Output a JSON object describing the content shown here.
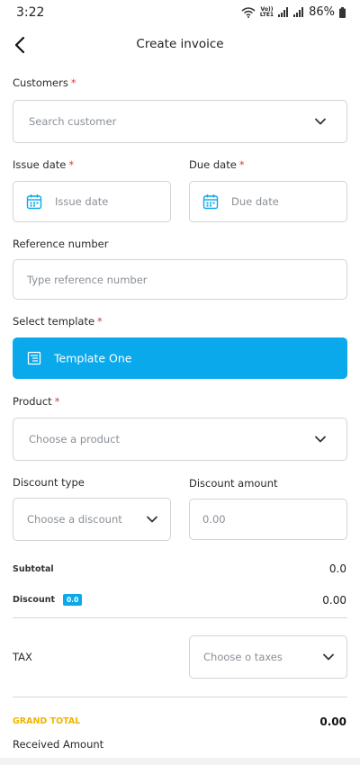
{
  "status": {
    "time": "3:22",
    "lte_top": "Vo))",
    "lte_bottom": "LTE1",
    "battery": "86%"
  },
  "header": {
    "title": "Create invoice"
  },
  "customers": {
    "label": "Customers",
    "required": "*",
    "placeholder": "Search customer"
  },
  "issue_date": {
    "label": "Issue date",
    "required": "*",
    "placeholder": "Issue date"
  },
  "due_date": {
    "label": "Due date",
    "required": "*",
    "placeholder": "Due date"
  },
  "reference": {
    "label": "Reference number",
    "placeholder": "Type reference number"
  },
  "template": {
    "label": "Select template",
    "required": "*",
    "selected": "Template One"
  },
  "product": {
    "label": "Product",
    "required": "*",
    "placeholder": "Choose a product"
  },
  "discount_type": {
    "label": "Discount type",
    "placeholder": "Choose a discount"
  },
  "discount_amount": {
    "label": "Discount amount",
    "placeholder": "0.00"
  },
  "summary": {
    "subtotal_label": "Subtotal",
    "subtotal_value": "0.0",
    "discount_label": "Discount",
    "discount_badge": "0.0",
    "discount_value": "0.00",
    "tax_label": "TAX",
    "tax_placeholder": "Choose o taxes",
    "grand_total_label": "GRAND TOTAL",
    "grand_total_value": "0.00",
    "received_label": "Received Amount"
  },
  "colors": {
    "accent": "#0aa9ec",
    "required": "#e53935",
    "grand_total": "#f0b400"
  }
}
